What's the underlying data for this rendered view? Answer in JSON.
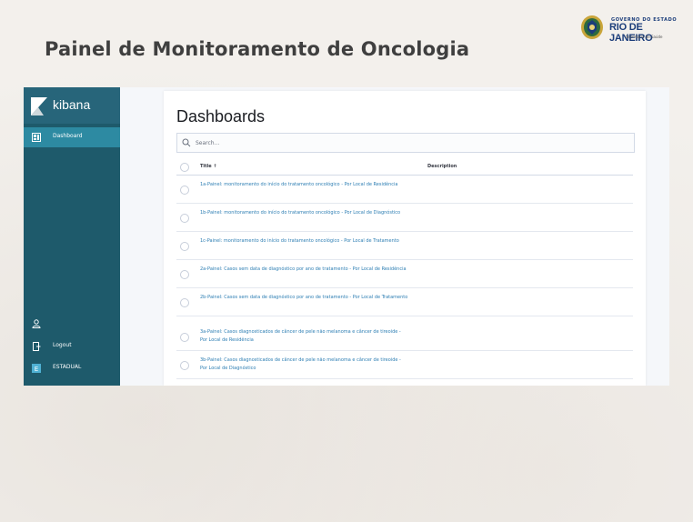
{
  "slide": {
    "title": "Painel de Monitoramento de Oncologia",
    "logo": {
      "line1": "GOVERNO DO ESTADO",
      "line2": "RIO DE JANEIRO",
      "line3": "Secretaria de Saúde"
    }
  },
  "sidebar": {
    "brand": "kibana",
    "items": [
      {
        "label": "Dashboard",
        "icon": "dashboard-icon",
        "active": true
      },
      {
        "label": "",
        "icon": "user-icon",
        "active": false
      },
      {
        "label": "Logout",
        "icon": "logout-icon",
        "active": false
      },
      {
        "label": "ESTADUAL",
        "icon": "space-badge-icon",
        "badge": "E",
        "active": false
      }
    ],
    "colors": {
      "background": "#1e5a6b",
      "active": "#2d8aa2"
    }
  },
  "main": {
    "title": "Dashboards",
    "search": {
      "placeholder": "Search..."
    },
    "table": {
      "columns": [
        "Title ↑",
        "Description"
      ],
      "rows": [
        {
          "title": "1a-Painel: monitoramento do início do tratamento oncológico - Por Local de Residência",
          "description": ""
        },
        {
          "title": "1b-Painel: monitoramento do início do tratamento oncológico - Por Local de Diagnóstico",
          "description": ""
        },
        {
          "title": "1c-Painel: monitoramento do início do tratamento oncológico - Por Local de Tratamento",
          "description": ""
        },
        {
          "title": "2a-Painel: Casos sem data de diagnóstico por ano de tratamento - Por Local de Residência",
          "description": ""
        },
        {
          "title": "2b-Painel: Casos sem data de diagnóstico por ano de tratamento - Por Local de Tratamento",
          "description": ""
        },
        {
          "title": "3a-Painel: Casos diagnosticados de câncer de pele não melanoma e câncer de tireoide - Por Local de Residência",
          "description": ""
        },
        {
          "title": "3b-Painel: Casos diagnosticados de câncer de pele não melanoma e câncer de tireoide - Por Local de Diagnóstico",
          "description": ""
        }
      ]
    },
    "colors": {
      "link": "#2d7eb3"
    }
  }
}
